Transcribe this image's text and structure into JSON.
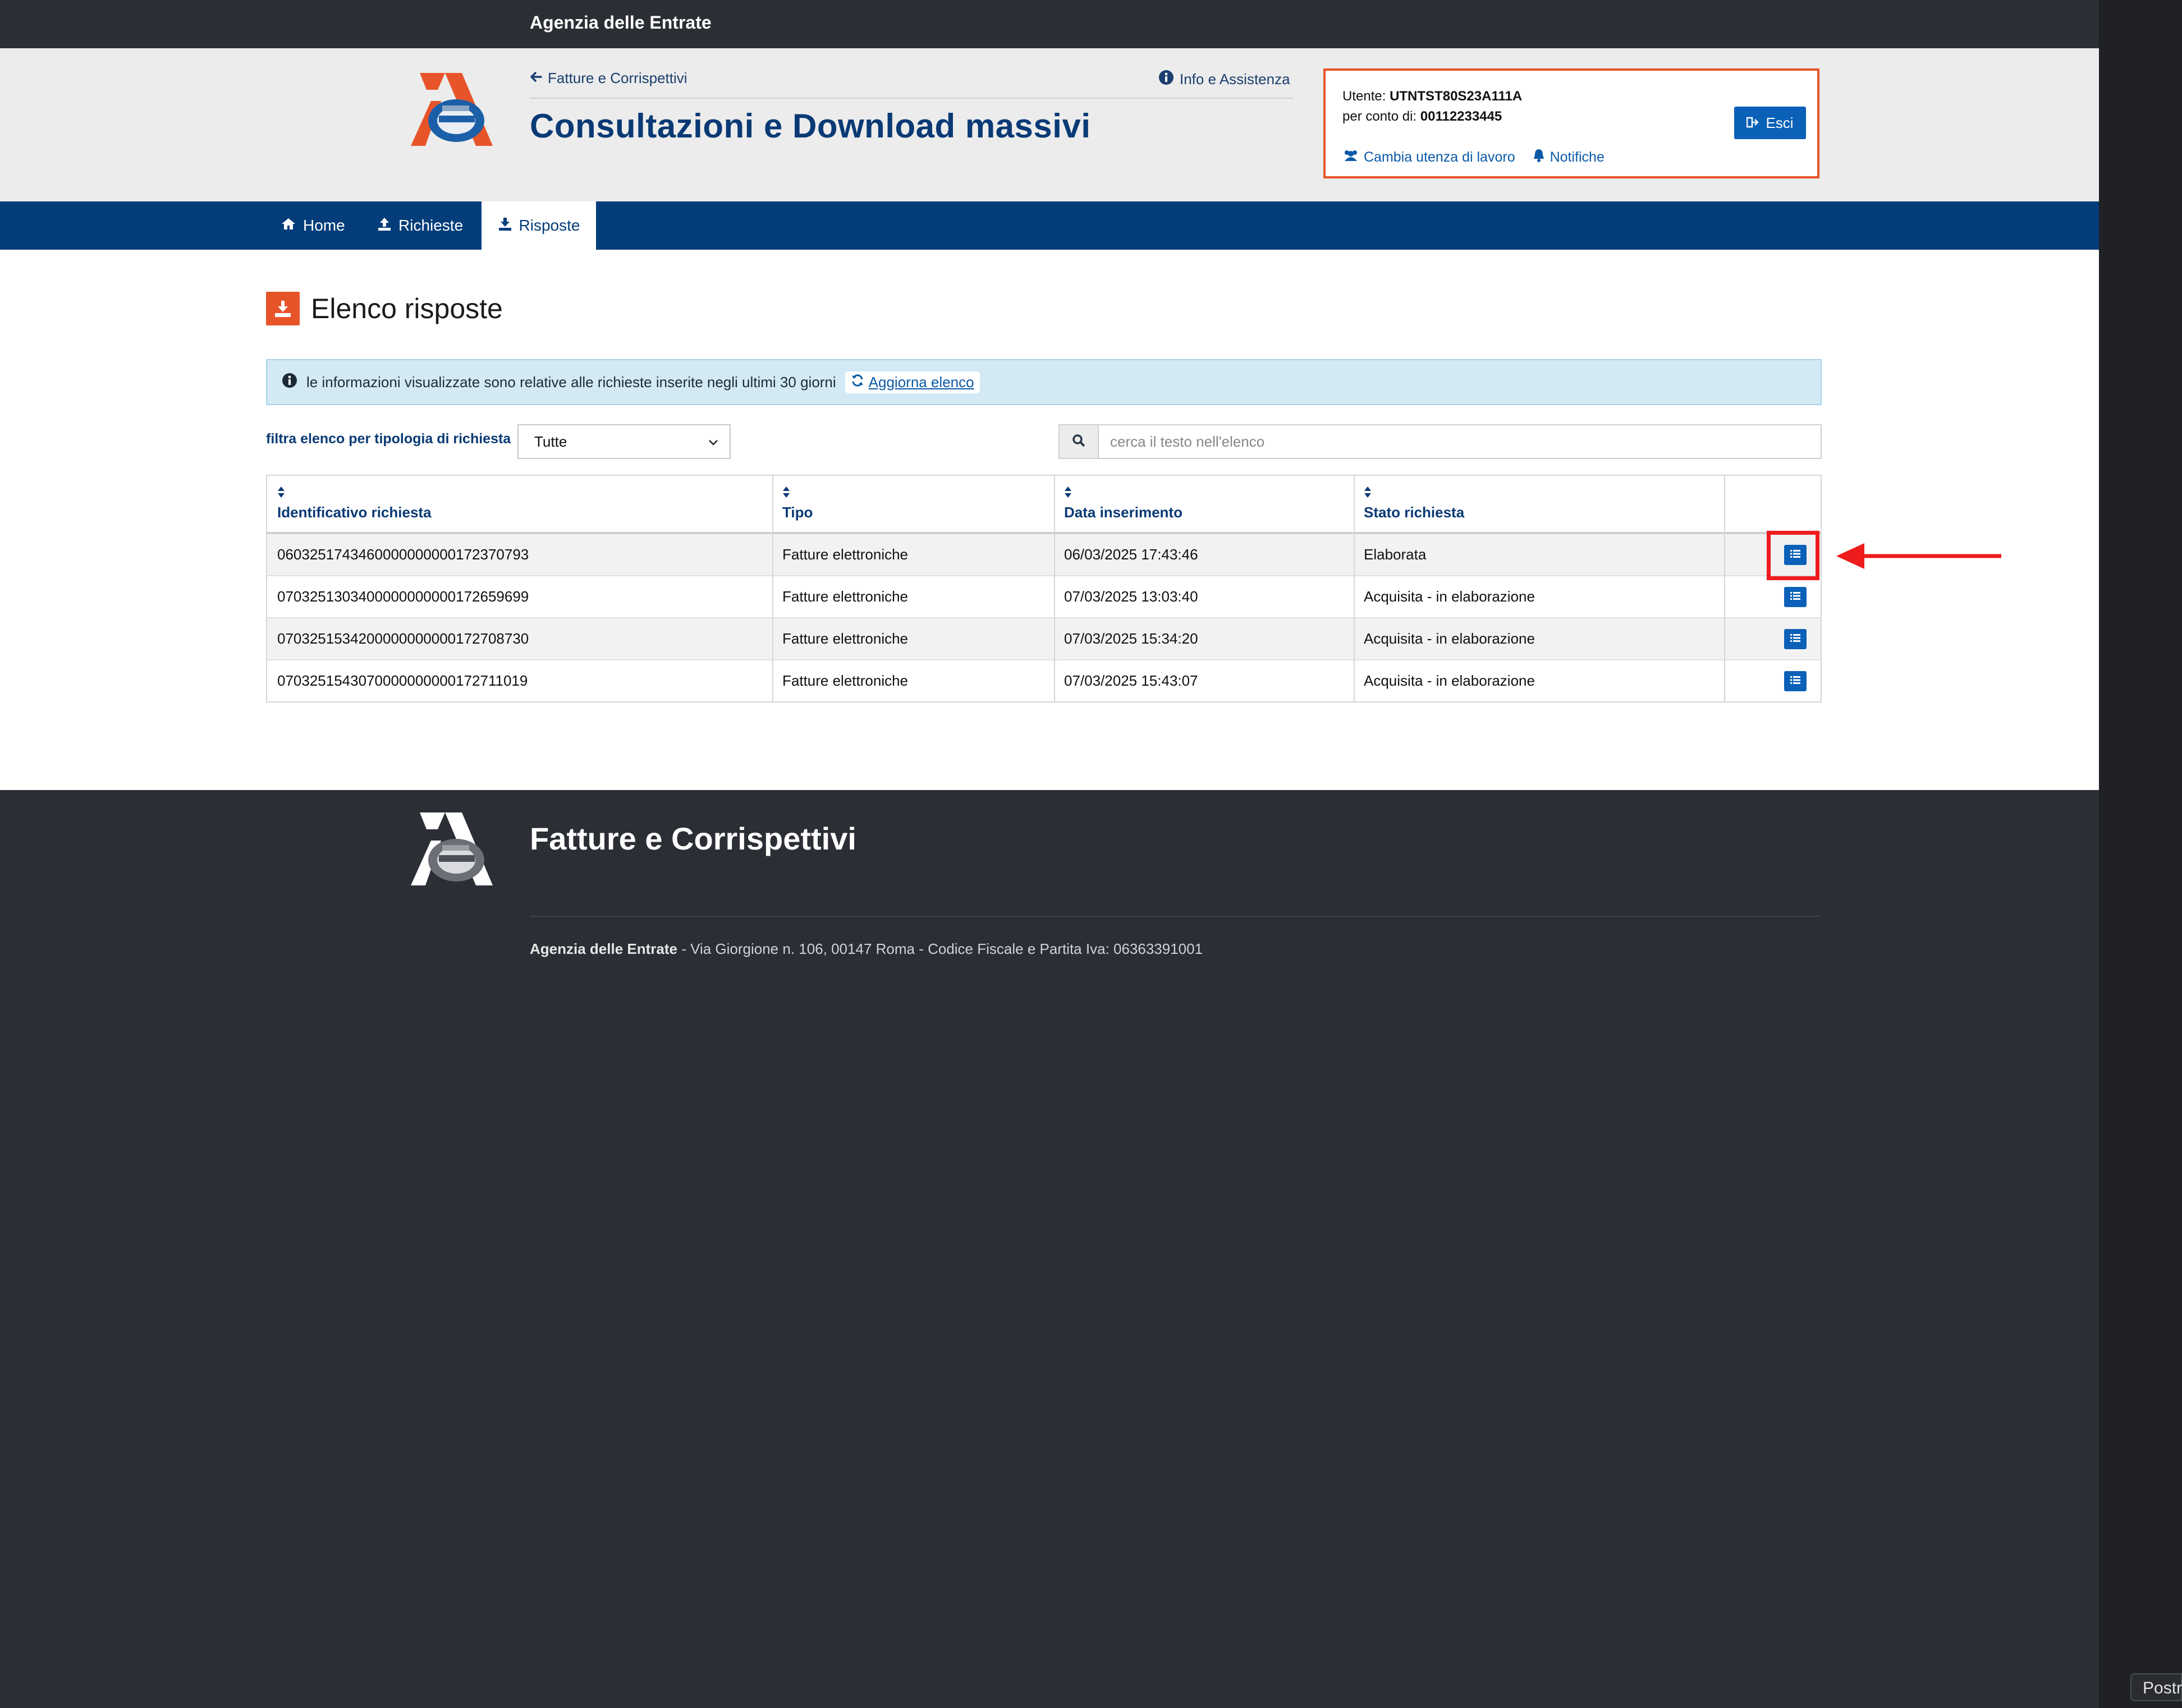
{
  "topbar": {
    "title": "Agenzia delle Entrate"
  },
  "header": {
    "back_link": "Fatture e Corrispettivi",
    "info_link": "Info e Assistenza",
    "app_title": "Consultazioni e Download massivi"
  },
  "user": {
    "user_label": "Utente:",
    "user_value": "UTNTST80S23A111A",
    "account_label": "per conto di:",
    "account_value": "00112233445",
    "exit_label": "Esci",
    "change_user_label": "Cambia utenza di lavoro",
    "notifications_label": "Notifiche"
  },
  "nav": {
    "items": [
      {
        "label": "Home",
        "icon": "home-icon"
      },
      {
        "label": "Richieste",
        "icon": "upload-icon"
      },
      {
        "label": "Risposte",
        "icon": "download-icon",
        "active": true
      }
    ]
  },
  "page": {
    "title": "Elenco risposte"
  },
  "alert": {
    "text": "le informazioni visualizzate sono relative alle richieste inserite negli ultimi 30 giorni",
    "refresh_label": "Aggiorna elenco"
  },
  "filter": {
    "label": "filtra elenco per tipologia di richiesta",
    "selected": "Tutte"
  },
  "search": {
    "placeholder": "cerca il testo nell'elenco"
  },
  "table": {
    "headers": [
      "Identificativo richiesta",
      "Tipo",
      "Data inserimento",
      "Stato richiesta"
    ],
    "rows": [
      {
        "id": "0603251743460000000000172370793",
        "tipo": "Fatture elettroniche",
        "data": "06/03/2025 17:43:46",
        "stato": "Elaborata"
      },
      {
        "id": "0703251303400000000000172659699",
        "tipo": "Fatture elettroniche",
        "data": "07/03/2025 13:03:40",
        "stato": "Acquisita - in elaborazione"
      },
      {
        "id": "0703251534200000000000172708730",
        "tipo": "Fatture elettroniche",
        "data": "07/03/2025 15:34:20",
        "stato": "Acquisita - in elaborazione"
      },
      {
        "id": "0703251543070000000000172711019",
        "tipo": "Fatture elettroniche",
        "data": "07/03/2025 15:43:07",
        "stato": "Acquisita - in elaborazione"
      }
    ]
  },
  "footer": {
    "title": "Fatture e Corrispettivi",
    "org": "Agenzia delle Entrate",
    "address": " - Via Giorgione n. 106, 00147 Roma - Codice Fiscale e Partita Iva: 06363391001"
  },
  "side_panel": {
    "label": "Postr"
  },
  "colors": {
    "brand_blue": "#043d7a",
    "accent_orange": "#e8542a",
    "button_blue": "#0b60b8",
    "annotation_red": "#ee1c1c",
    "footer_dark": "#2b2e34"
  }
}
